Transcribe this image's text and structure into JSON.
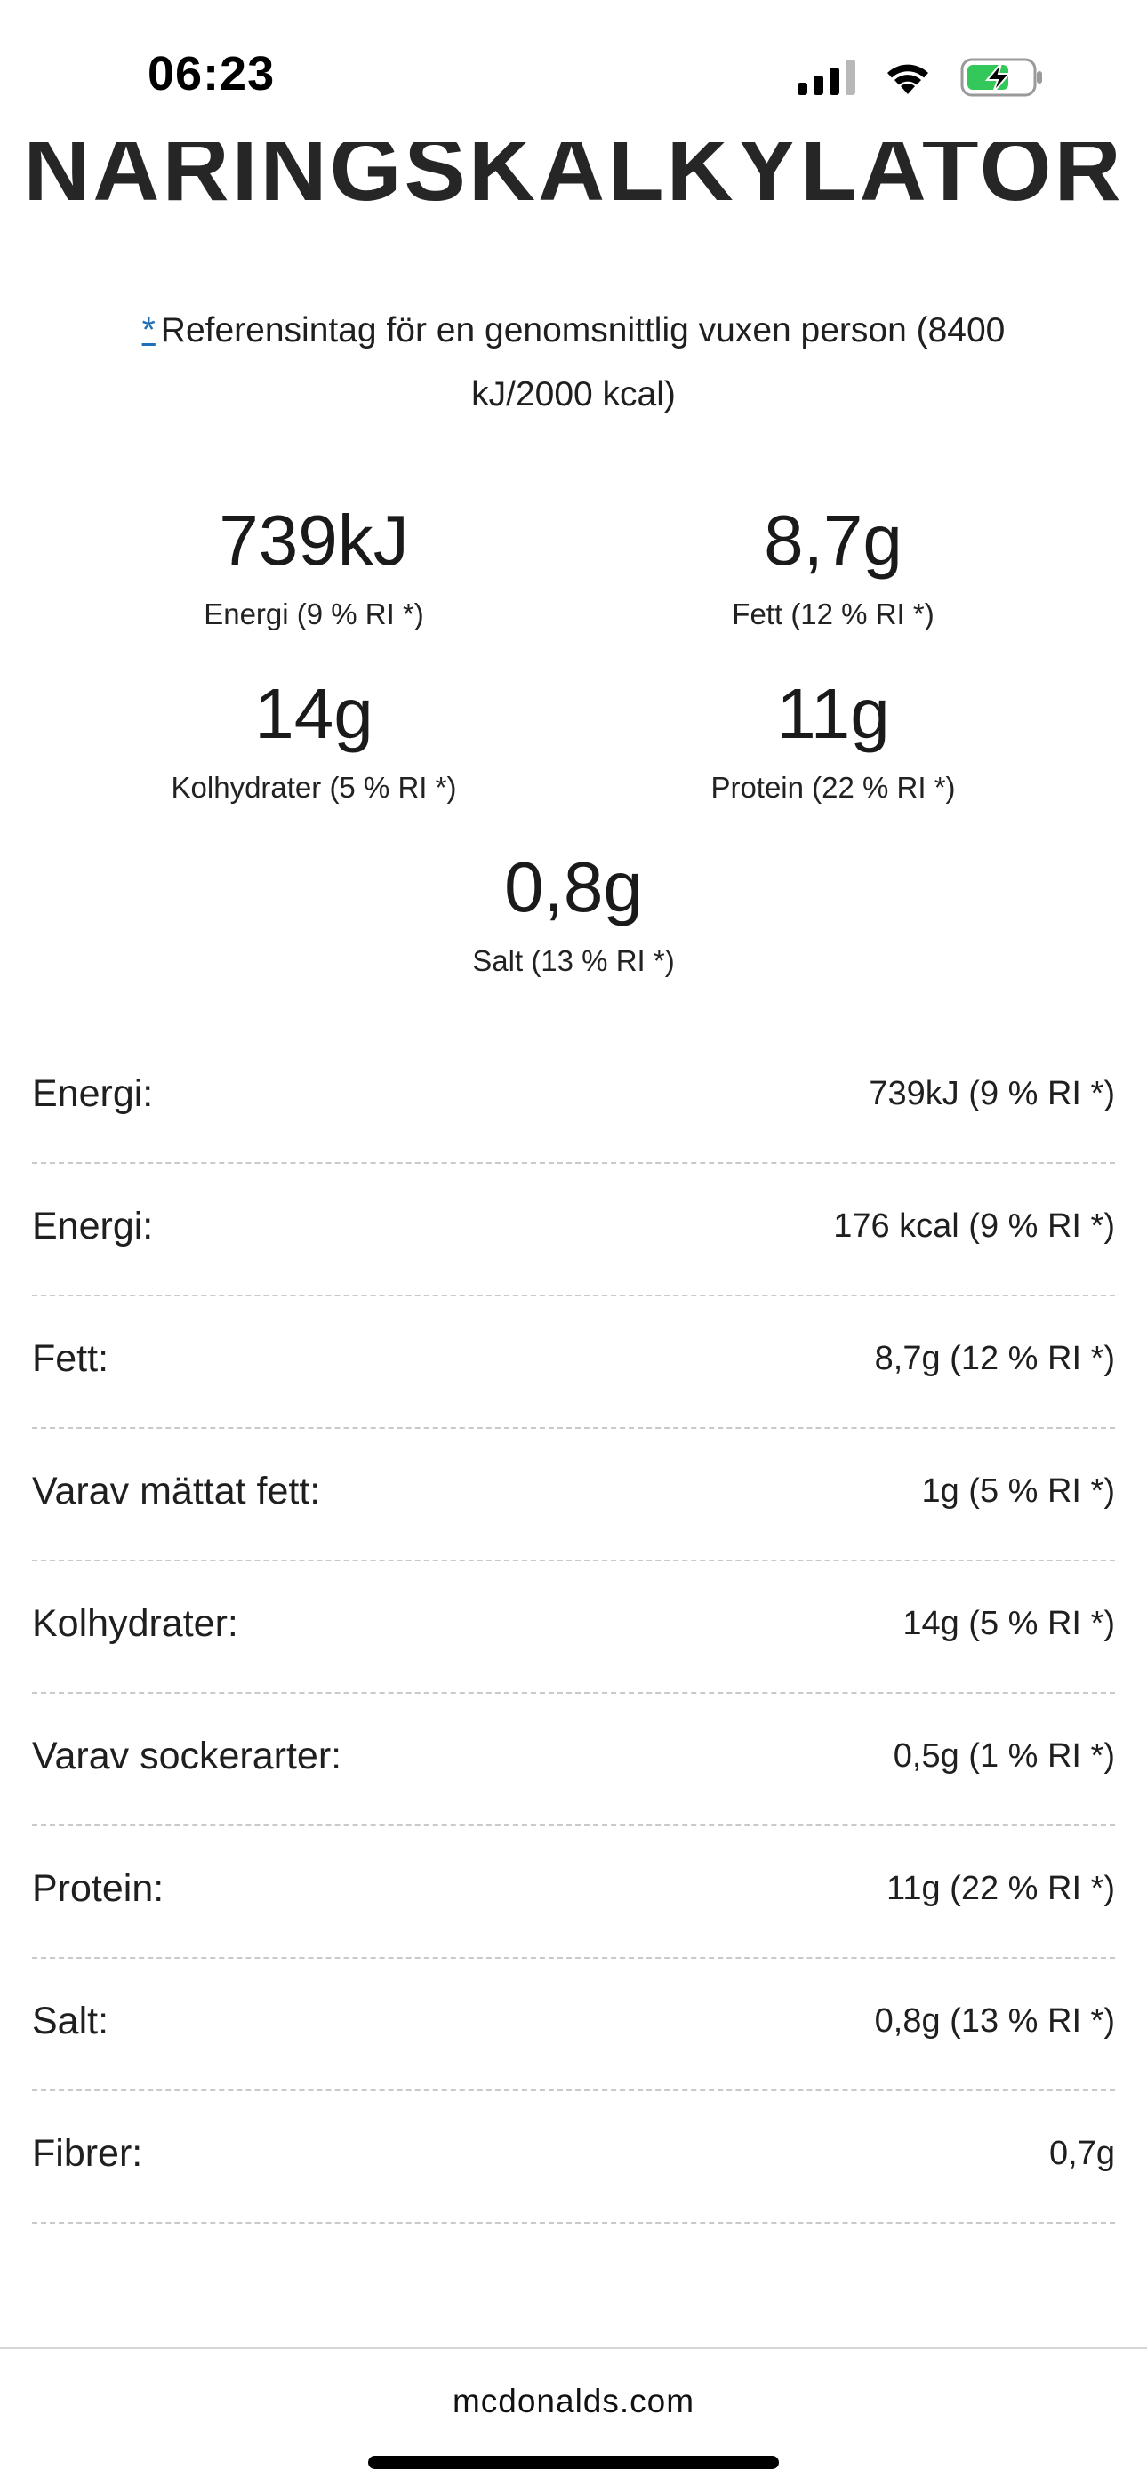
{
  "status_bar": {
    "time": "06:23",
    "icons": [
      "signal-icon",
      "wifi-icon",
      "battery-charging-icon"
    ],
    "battery_color": "#34c759"
  },
  "header": {
    "title": "NÄRINGSKALKYLATOR"
  },
  "reference": {
    "marker": "*",
    "text": "Referensintag för en genomsnittlig vuxen person (8400 kJ/2000 kcal)",
    "link_color": "#1f6fb8"
  },
  "highlights": [
    {
      "value": "739kJ",
      "label": "Energi (9 % RI *)"
    },
    {
      "value": "8,7g",
      "label": "Fett (12 % RI *)"
    },
    {
      "value": "14g",
      "label": "Kolhydrater (5 % RI *)"
    },
    {
      "value": "11g",
      "label": "Protein (22 % RI *)"
    },
    {
      "value": "0,8g",
      "label": "Salt (13 % RI *)"
    }
  ],
  "nutrients": [
    {
      "name": "Energi:",
      "value": "739kJ (9 % RI *)"
    },
    {
      "name": "Energi:",
      "value": "176 kcal (9 % RI *)"
    },
    {
      "name": "Fett:",
      "value": "8,7g (12 % RI *)"
    },
    {
      "name": "Varav mättat fett:",
      "value": "1g (5 % RI *)"
    },
    {
      "name": "Kolhydrater:",
      "value": "14g (5 % RI *)"
    },
    {
      "name": "Varav sockerarter:",
      "value": "0,5g (1 % RI *)"
    },
    {
      "name": "Protein:",
      "value": "11g (22 % RI *)"
    },
    {
      "name": "Salt:",
      "value": "0,8g (13 % RI *)"
    },
    {
      "name": "Fibrer:",
      "value": "0,7g"
    }
  ],
  "browser": {
    "domain": "mcdonalds.com"
  }
}
